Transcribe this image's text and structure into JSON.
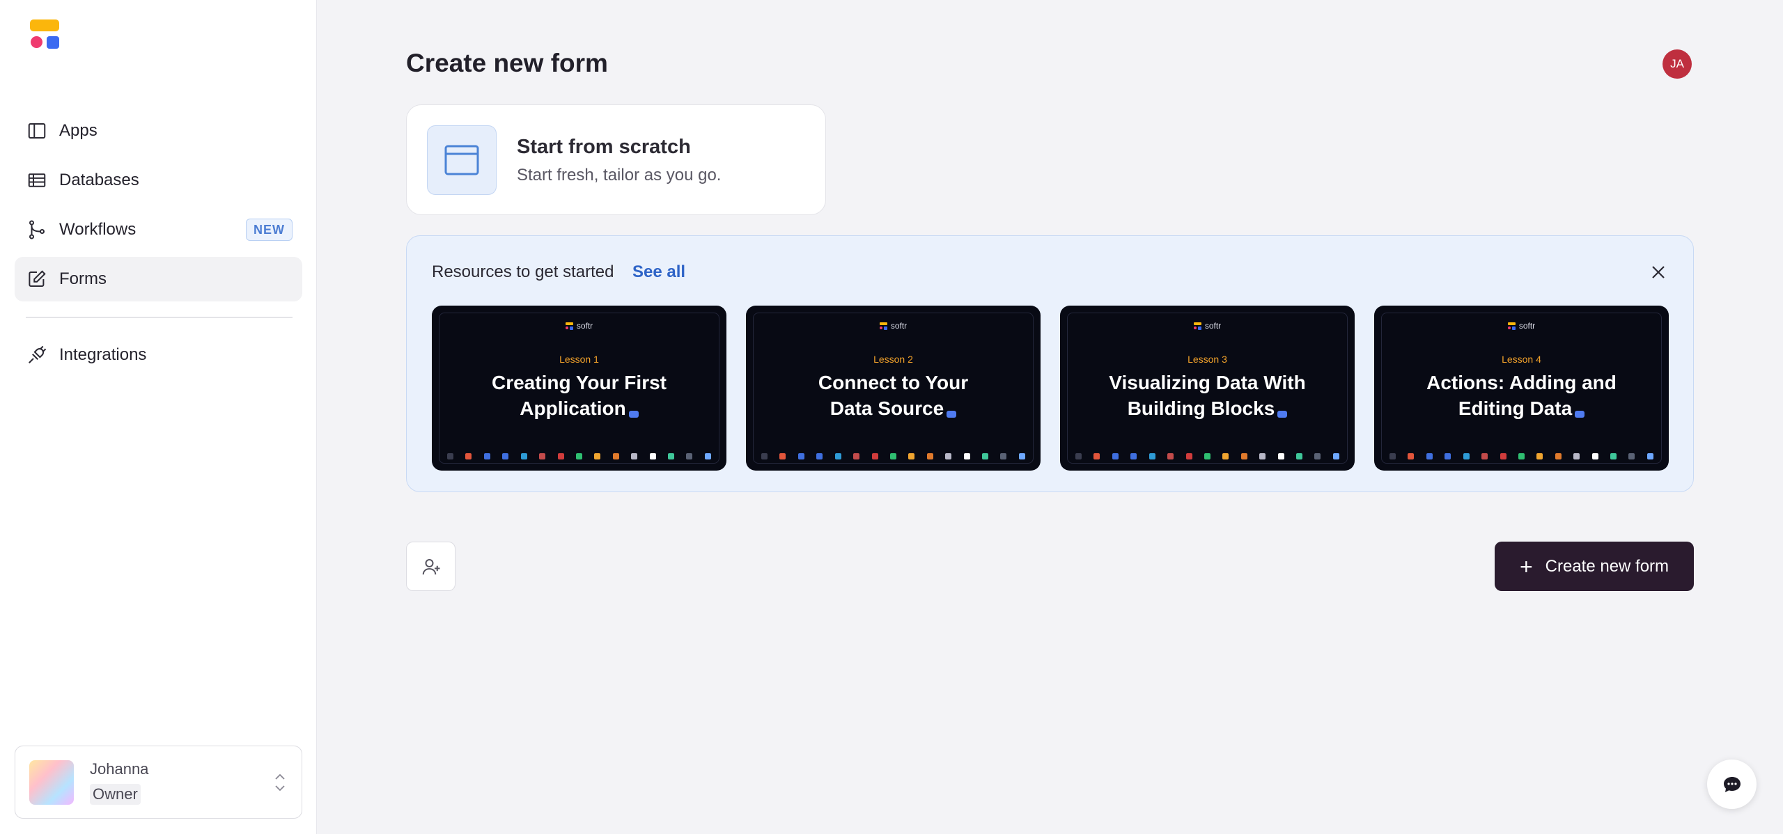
{
  "sidebar": {
    "nav": [
      {
        "label": "Apps",
        "icon": "panel-icon"
      },
      {
        "label": "Databases",
        "icon": "table-icon"
      },
      {
        "label": "Workflows",
        "icon": "workflow-icon",
        "badge": "NEW"
      },
      {
        "label": "Forms",
        "icon": "edit-icon",
        "active": true
      },
      {
        "label": "Integrations",
        "icon": "plug-icon"
      }
    ],
    "user": {
      "name": "Johanna",
      "role": "Owner"
    }
  },
  "header": {
    "title": "Create new form",
    "avatar_initials": "JA"
  },
  "scratch": {
    "title": "Start from scratch",
    "subtitle": "Start fresh, tailor as you go."
  },
  "resources": {
    "title": "Resources to get started",
    "see_all": "See all",
    "lessons": [
      {
        "brand": "softr",
        "number": "Lesson 1",
        "title_line1": "Creating Your First",
        "title_line2": "Application"
      },
      {
        "brand": "softr",
        "number": "Lesson 2",
        "title_line1": "Connect to Your",
        "title_line2": "Data Source"
      },
      {
        "brand": "softr",
        "number": "Lesson 3",
        "title_line1": "Visualizing Data With",
        "title_line2": "Building Blocks"
      },
      {
        "brand": "softr",
        "number": "Lesson 4",
        "title_line1": "Actions: Adding and",
        "title_line2": "Editing Data"
      }
    ]
  },
  "actions": {
    "create_label": "Create new form"
  },
  "colors": {
    "accent": "#2a1b2e",
    "link": "#2f64c7",
    "avatar": "#bf2f3f",
    "lesson_bg": "#080a14",
    "lesson_number": "#f3a32b"
  }
}
